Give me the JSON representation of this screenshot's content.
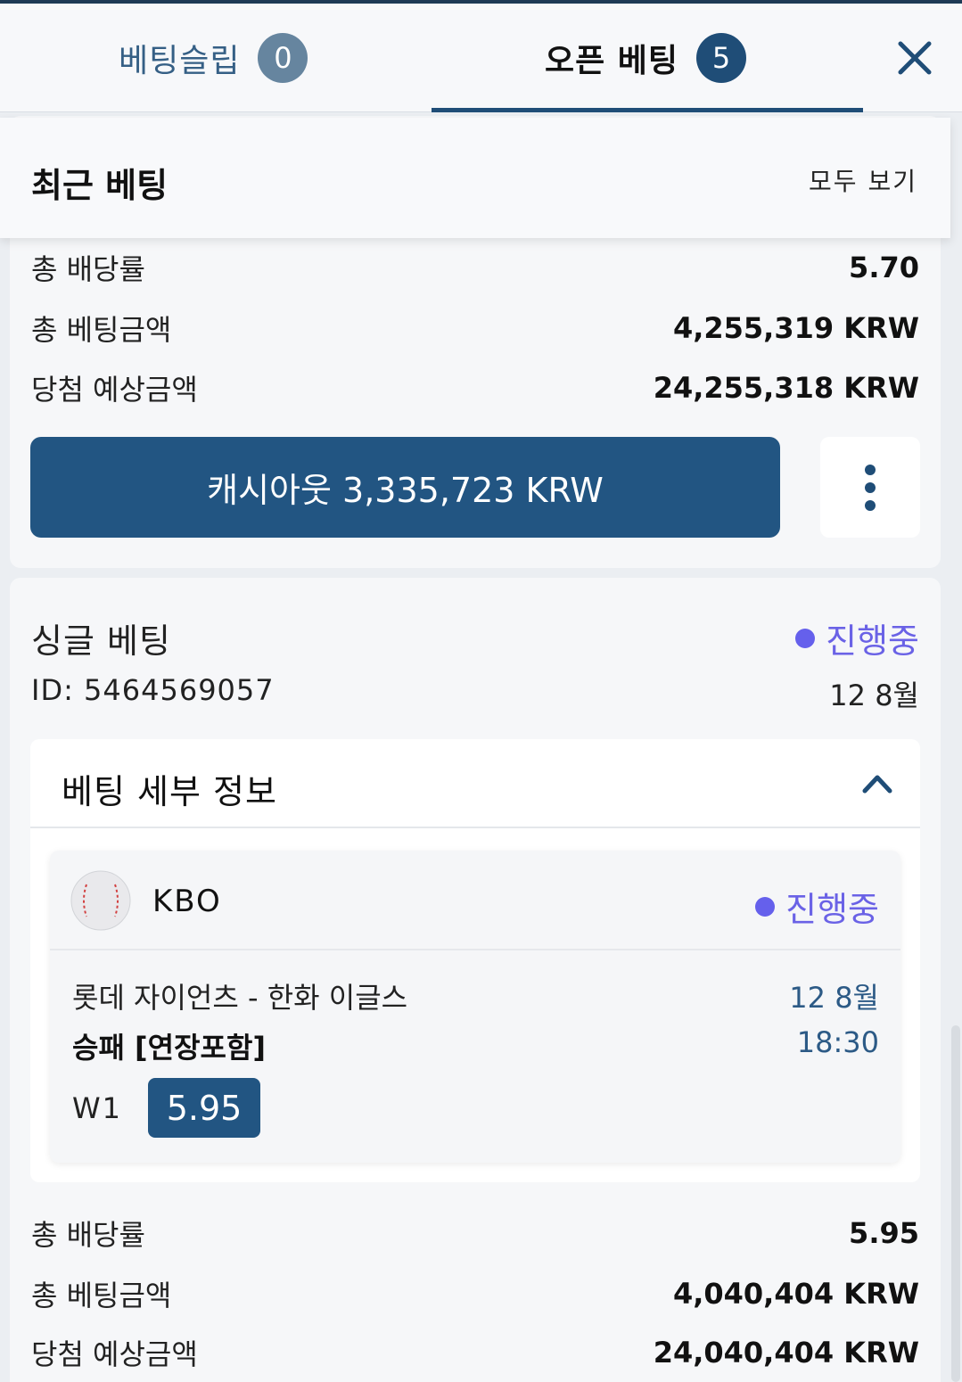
{
  "tabs": {
    "betslip": {
      "label": "베팅슬립",
      "count": "0"
    },
    "open_bets": {
      "label": "오픈 베팅",
      "count": "5"
    }
  },
  "recent": {
    "title": "최근 베팅",
    "view_all": "모두 보기"
  },
  "bet1": {
    "total_odds_label": "총 배당률",
    "total_odds": "5.70",
    "stake_label": "총 베팅금액",
    "stake": "4,255,319 KRW",
    "potential_label": "당첨 예상금액",
    "potential": "24,255,318 KRW",
    "cashout_label": "캐시아웃 3,335,723 KRW"
  },
  "bet2": {
    "type": "싱글 베팅",
    "status": "진행중",
    "id": "ID: 5464569057",
    "date": "12 8월",
    "details_title": "베팅 세부 정보",
    "event": {
      "league": "KBO",
      "status": "진행중",
      "match": "롯데 자이언츠 - 한화 이글스",
      "market": "승패 [연장포함]",
      "date": "12 8월",
      "time": "18:30",
      "pick": "W1",
      "odds": "5.95"
    },
    "total_odds_label": "총 배당률",
    "total_odds": "5.95",
    "stake_label": "총 베팅금액",
    "stake": "4,040,404 KRW",
    "potential_label": "당첨 예상금액",
    "potential": "24,040,404 KRW"
  },
  "colors": {
    "primary": "#225582",
    "status": "#6560ec",
    "background": "#ebeef2"
  },
  "icons": {
    "close": "close-icon",
    "more": "more-vertical-icon",
    "chevron": "chevron-up-icon",
    "sport": "baseball-icon"
  }
}
